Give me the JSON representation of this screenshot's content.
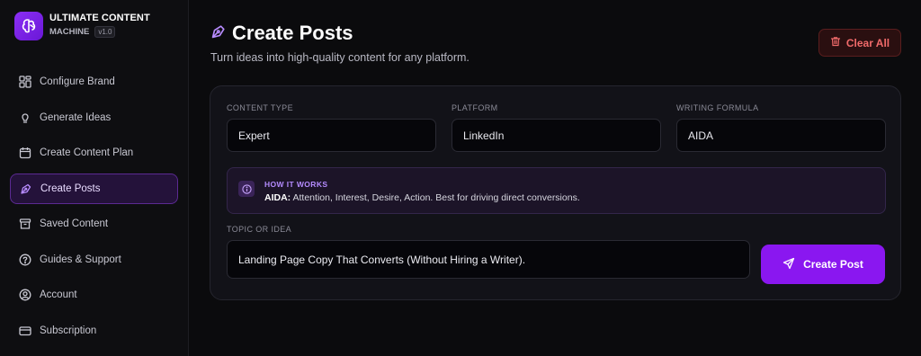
{
  "brand": {
    "title": "ULTIMATE CONTENT",
    "subtitle": "MACHINE",
    "version": "v1.0",
    "logo_icon": "brain-icon"
  },
  "sidebar": {
    "items": [
      {
        "label": "Configure Brand",
        "icon": "grid-icon"
      },
      {
        "label": "Generate Ideas",
        "icon": "lightbulb-icon"
      },
      {
        "label": "Create Content Plan",
        "icon": "calendar-icon"
      },
      {
        "label": "Create Posts",
        "icon": "pen-icon",
        "active": true
      },
      {
        "label": "Saved Content",
        "icon": "archive-icon"
      },
      {
        "label": "Guides & Support",
        "icon": "help-circle-icon"
      },
      {
        "label": "Account",
        "icon": "user-circle-icon"
      },
      {
        "label": "Subscription",
        "icon": "credit-card-icon"
      }
    ]
  },
  "header": {
    "title": "Create Posts",
    "subtitle": "Turn ideas into high-quality content for any platform.",
    "clear_label": "Clear All"
  },
  "form": {
    "content_type": {
      "label": "CONTENT TYPE",
      "value": "Expert"
    },
    "platform": {
      "label": "PLATFORM",
      "value": "LinkedIn"
    },
    "writing_formula": {
      "label": "WRITING FORMULA",
      "value": "AIDA"
    },
    "info": {
      "title": "HOW IT WORKS",
      "term": "AIDA:",
      "text": " Attention, Interest, Desire, Action. Best for driving direct conversions."
    },
    "topic": {
      "label": "TOPIC OR IDEA",
      "value": "Landing Page Copy That Converts (Without Hiring a Writer)."
    },
    "create_label": "Create Post"
  },
  "colors": {
    "accent": "#8a17f0",
    "danger": "#f06a6a",
    "background": "#0b0b0d"
  }
}
